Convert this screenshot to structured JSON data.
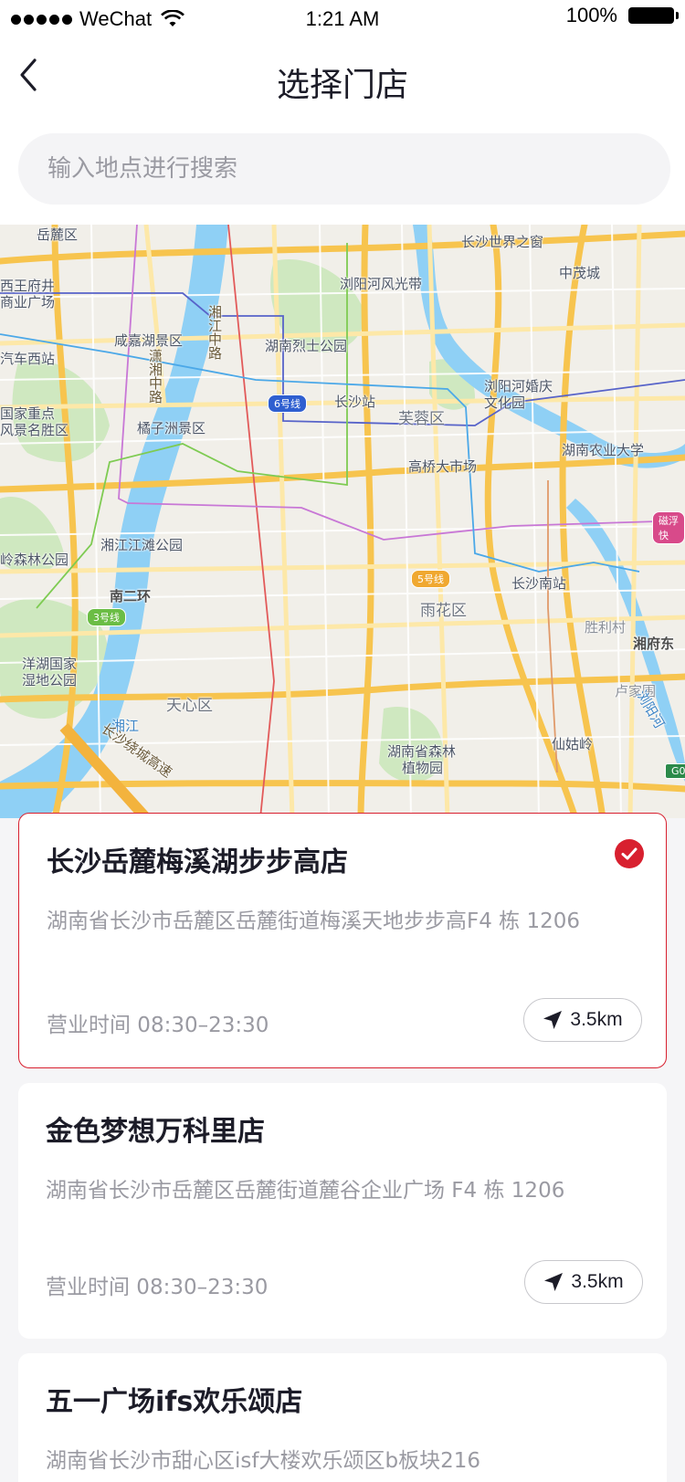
{
  "status_bar": {
    "carrier": "WeChat",
    "time": "1:21 AM",
    "battery": "100%"
  },
  "nav": {
    "title": "选择门店",
    "back_icon": "chevron-left-icon"
  },
  "search": {
    "placeholder": "输入地点进行搜索"
  },
  "map": {
    "labels": {
      "yuelu": "岳麓区",
      "world_window": "长沙世界之窗",
      "xiwangfujing": "西王府井",
      "commercial_plaza": "商业广场",
      "zhongmao": "中茂城",
      "liuyanghe_scenic": "浏阳河风光带",
      "xianjiahu": "咸嘉湖景区",
      "martyrs_park": "湖南烈士公园",
      "west_bus_station": "汽车西站",
      "xiangjiang_mid": "湘江中路",
      "xiaoxiang": "潇湘中路",
      "metro6": "6号线",
      "changsha_station": "长沙站",
      "liuyanghe_wedding": "浏阳河婚庆",
      "culture_park": "文化园",
      "national_scenic": "国家重点",
      "scenic_area": "风景名胜区",
      "orange_isle": "橘子洲景区",
      "furong": "芙蓉区",
      "agri_univ": "湖南农业大学",
      "gaoqiao": "高桥大市场",
      "cixu": "磁浮快",
      "jiangtan_park": "湘江江滩公园",
      "forest_park": "岭森林公园",
      "metro5": "5号线",
      "south_station": "长沙南站",
      "nan_ring": "南二环",
      "metro3": "3号线",
      "yuhua": "雨花区",
      "shengli": "胜利村",
      "xiangfu_east": "湘府东",
      "yangzhou_park": "洋湖国家",
      "wetland_park": "湿地公园",
      "tianxin": "天心区",
      "lujiawei": "卢家围",
      "xiangjiang_river": "湘江",
      "around_highway": "长沙绕城高速",
      "forest_botanical": "湖南省森林",
      "botanical_garden": "植物园",
      "xiangu": "仙姑岭",
      "liuyang_river": "浏阳河",
      "g0": "G0"
    }
  },
  "stores": [
    {
      "name": "长沙岳麓梅溪湖步步高店",
      "address": "湖南省长沙市岳麓区岳麓街道梅溪天地步步高F4 栋 1206",
      "hours": "营业时间 08:30–23:30",
      "distance": "3.5km",
      "selected": true
    },
    {
      "name": "金色梦想万科里店",
      "address": "湖南省长沙市岳麓区岳麓街道麓谷企业广场 F4 栋 1206",
      "hours": "营业时间 08:30–23:30",
      "distance": "3.5km",
      "selected": false
    },
    {
      "name": "五一广场ifs欢乐颂店",
      "address": "湖南省长沙市甜心区isf大楼欢乐颂区b板块216"
    }
  ],
  "colors": {
    "accent": "#d8202f",
    "river": "#8fd0f5",
    "park": "#cfe8c0",
    "main_road": "#f7c44e",
    "minor_road": "#fde8a8"
  }
}
